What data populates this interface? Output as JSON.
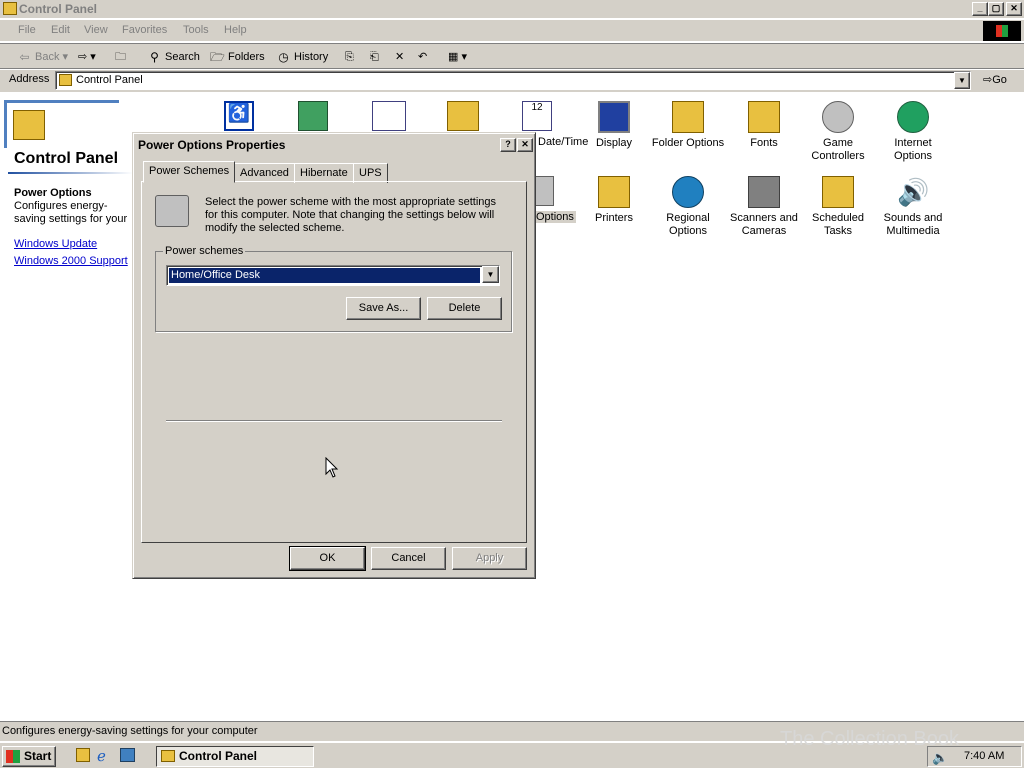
{
  "window": {
    "title": "Control Panel",
    "min_label": "_",
    "max_label": "▢",
    "close_label": "✕"
  },
  "menu": [
    "File",
    "Edit",
    "View",
    "Favorites",
    "Tools",
    "Help"
  ],
  "toolbar": {
    "back": "Back",
    "forward": "",
    "up": "",
    "search": "Search",
    "folders": "Folders",
    "history": "History"
  },
  "address": {
    "label": "Address",
    "value": "Control Panel",
    "go": "Go"
  },
  "left_pane": {
    "title": "Control Panel",
    "selected_name": "Power Options",
    "selected_desc": "Configures energy-saving settings for your computer",
    "links": [
      "Windows Update",
      "Windows 2000 Support"
    ]
  },
  "icons": {
    "date_time": "Date/Time",
    "display": "Display",
    "folder_options": "Folder Options",
    "fonts": "Fonts",
    "game_controllers": "Game Controllers",
    "internet_options": "Internet Options",
    "power_options": "Options",
    "printers": "Printers",
    "regional_options": "Regional Options",
    "scanners": "Scanners and Cameras",
    "scheduled_tasks": "Scheduled Tasks",
    "sounds": "Sounds and Multimedia"
  },
  "dialog": {
    "title": "Power Options Properties",
    "help_label": "?",
    "close_label": "✕",
    "tabs": [
      "Power Schemes",
      "Advanced",
      "Hibernate",
      "UPS"
    ],
    "description": "Select the power scheme with the most appropriate settings for this computer. Note that changing the settings below will modify the selected scheme.",
    "group_label": "Power schemes",
    "scheme_value": "Home/Office Desk",
    "save_as": "Save As...",
    "delete": "Delete",
    "ok": "OK",
    "cancel": "Cancel",
    "apply": "Apply"
  },
  "status": {
    "text": "Configures energy-saving settings for your computer"
  },
  "taskbar": {
    "start": "Start",
    "task": "Control Panel",
    "clock": "7:40 AM"
  },
  "watermark": "The Collection Book"
}
